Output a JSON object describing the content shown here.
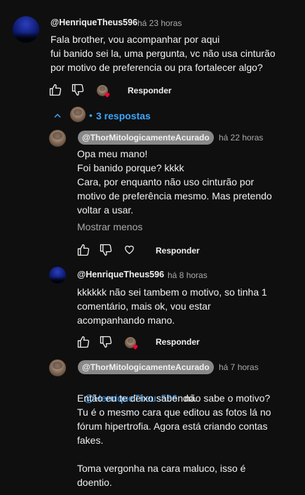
{
  "comment": {
    "author": "@HenriqueTheus596",
    "time": "há 23 horas",
    "lines": [
      "Fala brother, vou acompanhar por aqui",
      "fui banido sei la, uma pergunta, vc não usa cinturão",
      "por motivo de preferencia ou pra fortalecer algo?"
    ],
    "reply_label": "Responder"
  },
  "replies_toggle": {
    "separator": "•",
    "count_label": "3 respostas"
  },
  "replies": [
    {
      "author": "@ThorMitologicamenteAcurado",
      "time": "há 22 horas",
      "lines": [
        "Opa meu mano!",
        "Foi banido porque? kkkk",
        "Cara, por enquanto não uso cinturão por",
        "motivo de preferência mesmo. Mas pretendo",
        "voltar a usar."
      ],
      "show_less": "Mostrar menos",
      "reply_label": "Responder"
    },
    {
      "author": "@HenriqueTheus596",
      "time": "há 8 horas",
      "lines": [
        "kkkkkk não sei tambem o motivo, so tinha 1",
        "comentário, mais ok, vou estar",
        "acompanhando mano."
      ],
      "reply_label": "Responder"
    },
    {
      "author": "@ThorMitologicamenteAcurado",
      "time": "há 7 horas",
      "mention": "@HenriqueTheus596",
      "first_line_rest": "não sabe o motivo?",
      "lines": [
        "Então eu te deixo sabendo.",
        "Tu é o mesmo cara que editou as fotos lá no",
        "fórum hipertrofia. Agora está criando contas",
        "fakes.",
        "",
        "Toma vergonha na cara maluco, isso é",
        "doentio."
      ]
    }
  ],
  "colors": {
    "background": "#0f0f0f",
    "text": "#f1f1f1",
    "secondary_text": "#aaaaaa",
    "link": "#3ea6ff",
    "author_chip": "#888888",
    "heart": "#ff0033"
  }
}
